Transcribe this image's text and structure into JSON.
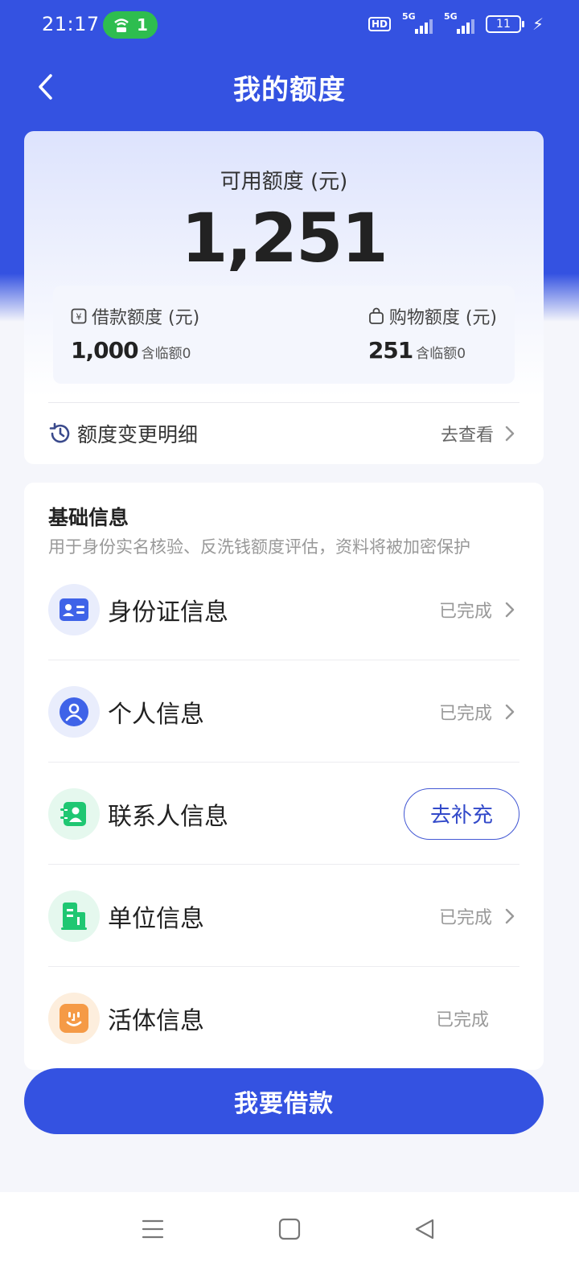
{
  "status_bar": {
    "time": "21:17",
    "hotspot_count": "1",
    "hd_label": "HD",
    "network_1": "5G",
    "network_2": "5G",
    "battery": "11"
  },
  "header": {
    "title": "我的额度"
  },
  "credit": {
    "available_label": "可用额度 (元)",
    "available_amount": "1,251",
    "loan_label": "借款额度 (元)",
    "loan_amount": "1,000",
    "loan_note": "含临额0",
    "shopping_label": "购物额度 (元)",
    "shopping_amount": "251",
    "shopping_note": "含临额0",
    "history_label": "额度变更明细",
    "history_link": "去查看"
  },
  "basic_info": {
    "title": "基础信息",
    "description": "用于身份实名核验、反洗钱额度评估，资料将被加密保护",
    "items": [
      {
        "label": "身份证信息",
        "status": "已完成",
        "icon": "id-card-icon",
        "icon_bg": "#e9edfc",
        "icon_color": "#3f63e8"
      },
      {
        "label": "个人信息",
        "status": "已完成",
        "icon": "person-icon",
        "icon_bg": "#e9edfc",
        "icon_color": "#3f63e8"
      },
      {
        "label": "联系人信息",
        "action": "去补充",
        "icon": "contacts-icon",
        "icon_bg": "#e5f8ee",
        "icon_color": "#1fc772"
      },
      {
        "label": "单位信息",
        "status": "已完成",
        "icon": "building-icon",
        "icon_bg": "#e5f8ee",
        "icon_color": "#1fc772"
      },
      {
        "label": "活体信息",
        "status": "已完成",
        "icon": "face-icon",
        "icon_bg": "#fdeedd",
        "icon_color": "#f59a46"
      }
    ]
  },
  "primary_action": {
    "label": "我要借款"
  },
  "colors": {
    "brand": "#3452e1",
    "success_green": "#2ebd4f"
  }
}
